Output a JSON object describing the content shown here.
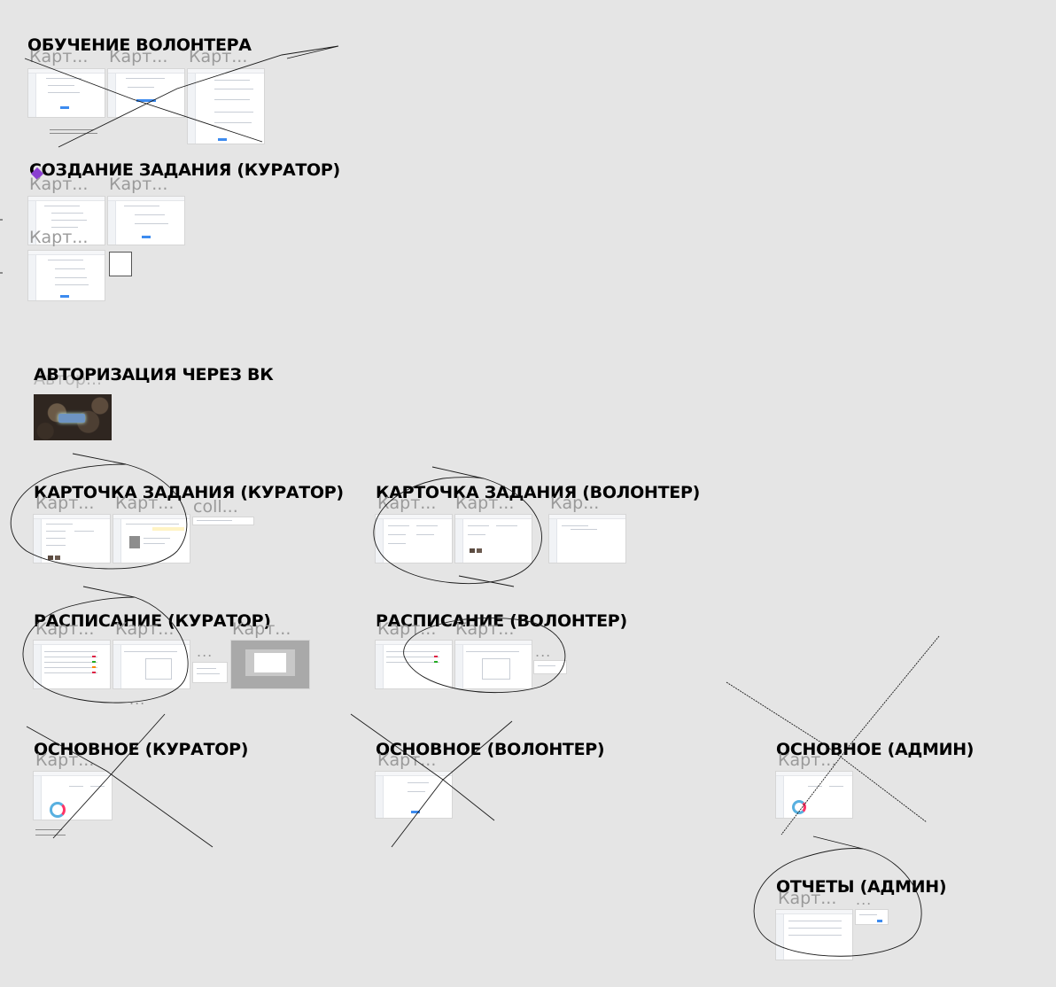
{
  "sections": [
    {
      "id": "volunteer-training",
      "title": "ОБУЧЕНИЕ ВОЛОНТЕРА",
      "frames": [
        "Карт...",
        "Карт...",
        "Карт..."
      ]
    },
    {
      "id": "task-creation-curator",
      "title": "СОЗДАНИЕ ЗАДАНИЯ (КУРАТОР)",
      "frames": [
        "Карт...",
        "Карт...",
        "Карт..."
      ]
    },
    {
      "id": "vk-auth",
      "title": "АВТОРИЗАЦИЯ ЧЕРЕЗ ВК",
      "frames": [
        "Автор..."
      ]
    },
    {
      "id": "task-card-curator",
      "title": "КАРТОЧКА ЗАДАНИЯ (КУРАТОР)",
      "frames": [
        "Карт...",
        "Карт...",
        "coll..."
      ]
    },
    {
      "id": "task-card-volunteer",
      "title": "КАРТОЧКА ЗАДАНИЯ (ВОЛОНТЕР)",
      "frames": [
        "Карт...",
        "Карт...",
        "Кар..."
      ]
    },
    {
      "id": "schedule-curator",
      "title": "РАСПИСАНИЕ (КУРАТОР)",
      "frames": [
        "Карт...",
        "Карт...",
        "Карт..."
      ],
      "extras": [
        "...",
        "..."
      ]
    },
    {
      "id": "schedule-volunteer",
      "title": "РАСПИСАНИЕ (ВОЛОНТЕР)",
      "frames": [
        "Карт...",
        "Карт..."
      ],
      "extras": [
        "..."
      ]
    },
    {
      "id": "main-curator",
      "title": "ОСНОВНОЕ (КУРАТОР)",
      "frames": [
        "Карт..."
      ]
    },
    {
      "id": "main-volunteer",
      "title": "ОСНОВНОЕ (ВОЛОНТЕР)",
      "frames": [
        "Карт..."
      ]
    },
    {
      "id": "main-admin",
      "title": "ОСНОВНОЕ (АДМИН)",
      "frames": [
        "Карт..."
      ]
    },
    {
      "id": "reports-admin",
      "title": "ОТЧЕТЫ (АДМИН)",
      "frames": [
        "Карт..."
      ],
      "extras": [
        "..."
      ]
    }
  ],
  "colors": {
    "canvas": "#e5e5e5",
    "title": "#000000",
    "frame_label": "#9a9a9a",
    "sketch_stroke": "#1a1a1a",
    "sticker": "#8a3fd1",
    "accent": "#3d8bef"
  }
}
